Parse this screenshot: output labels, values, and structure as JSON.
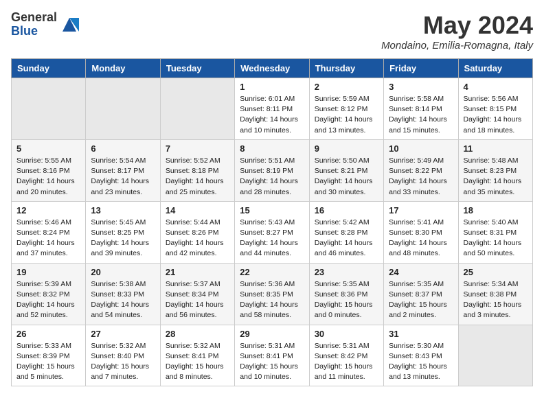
{
  "logo": {
    "general": "General",
    "blue": "Blue"
  },
  "title": "May 2024",
  "location": "Mondaino, Emilia-Romagna, Italy",
  "days_of_week": [
    "Sunday",
    "Monday",
    "Tuesday",
    "Wednesday",
    "Thursday",
    "Friday",
    "Saturday"
  ],
  "weeks": [
    {
      "days": [
        {
          "number": "",
          "info": "",
          "empty": true
        },
        {
          "number": "",
          "info": "",
          "empty": true
        },
        {
          "number": "",
          "info": "",
          "empty": true
        },
        {
          "number": "1",
          "info": "Sunrise: 6:01 AM\nSunset: 8:11 PM\nDaylight: 14 hours\nand 10 minutes."
        },
        {
          "number": "2",
          "info": "Sunrise: 5:59 AM\nSunset: 8:12 PM\nDaylight: 14 hours\nand 13 minutes."
        },
        {
          "number": "3",
          "info": "Sunrise: 5:58 AM\nSunset: 8:14 PM\nDaylight: 14 hours\nand 15 minutes."
        },
        {
          "number": "4",
          "info": "Sunrise: 5:56 AM\nSunset: 8:15 PM\nDaylight: 14 hours\nand 18 minutes."
        }
      ]
    },
    {
      "days": [
        {
          "number": "5",
          "info": "Sunrise: 5:55 AM\nSunset: 8:16 PM\nDaylight: 14 hours\nand 20 minutes."
        },
        {
          "number": "6",
          "info": "Sunrise: 5:54 AM\nSunset: 8:17 PM\nDaylight: 14 hours\nand 23 minutes."
        },
        {
          "number": "7",
          "info": "Sunrise: 5:52 AM\nSunset: 8:18 PM\nDaylight: 14 hours\nand 25 minutes."
        },
        {
          "number": "8",
          "info": "Sunrise: 5:51 AM\nSunset: 8:19 PM\nDaylight: 14 hours\nand 28 minutes."
        },
        {
          "number": "9",
          "info": "Sunrise: 5:50 AM\nSunset: 8:21 PM\nDaylight: 14 hours\nand 30 minutes."
        },
        {
          "number": "10",
          "info": "Sunrise: 5:49 AM\nSunset: 8:22 PM\nDaylight: 14 hours\nand 33 minutes."
        },
        {
          "number": "11",
          "info": "Sunrise: 5:48 AM\nSunset: 8:23 PM\nDaylight: 14 hours\nand 35 minutes."
        }
      ]
    },
    {
      "days": [
        {
          "number": "12",
          "info": "Sunrise: 5:46 AM\nSunset: 8:24 PM\nDaylight: 14 hours\nand 37 minutes."
        },
        {
          "number": "13",
          "info": "Sunrise: 5:45 AM\nSunset: 8:25 PM\nDaylight: 14 hours\nand 39 minutes."
        },
        {
          "number": "14",
          "info": "Sunrise: 5:44 AM\nSunset: 8:26 PM\nDaylight: 14 hours\nand 42 minutes."
        },
        {
          "number": "15",
          "info": "Sunrise: 5:43 AM\nSunset: 8:27 PM\nDaylight: 14 hours\nand 44 minutes."
        },
        {
          "number": "16",
          "info": "Sunrise: 5:42 AM\nSunset: 8:28 PM\nDaylight: 14 hours\nand 46 minutes."
        },
        {
          "number": "17",
          "info": "Sunrise: 5:41 AM\nSunset: 8:30 PM\nDaylight: 14 hours\nand 48 minutes."
        },
        {
          "number": "18",
          "info": "Sunrise: 5:40 AM\nSunset: 8:31 PM\nDaylight: 14 hours\nand 50 minutes."
        }
      ]
    },
    {
      "days": [
        {
          "number": "19",
          "info": "Sunrise: 5:39 AM\nSunset: 8:32 PM\nDaylight: 14 hours\nand 52 minutes."
        },
        {
          "number": "20",
          "info": "Sunrise: 5:38 AM\nSunset: 8:33 PM\nDaylight: 14 hours\nand 54 minutes."
        },
        {
          "number": "21",
          "info": "Sunrise: 5:37 AM\nSunset: 8:34 PM\nDaylight: 14 hours\nand 56 minutes."
        },
        {
          "number": "22",
          "info": "Sunrise: 5:36 AM\nSunset: 8:35 PM\nDaylight: 14 hours\nand 58 minutes."
        },
        {
          "number": "23",
          "info": "Sunrise: 5:35 AM\nSunset: 8:36 PM\nDaylight: 15 hours\nand 0 minutes."
        },
        {
          "number": "24",
          "info": "Sunrise: 5:35 AM\nSunset: 8:37 PM\nDaylight: 15 hours\nand 2 minutes."
        },
        {
          "number": "25",
          "info": "Sunrise: 5:34 AM\nSunset: 8:38 PM\nDaylight: 15 hours\nand 3 minutes."
        }
      ]
    },
    {
      "days": [
        {
          "number": "26",
          "info": "Sunrise: 5:33 AM\nSunset: 8:39 PM\nDaylight: 15 hours\nand 5 minutes."
        },
        {
          "number": "27",
          "info": "Sunrise: 5:32 AM\nSunset: 8:40 PM\nDaylight: 15 hours\nand 7 minutes."
        },
        {
          "number": "28",
          "info": "Sunrise: 5:32 AM\nSunset: 8:41 PM\nDaylight: 15 hours\nand 8 minutes."
        },
        {
          "number": "29",
          "info": "Sunrise: 5:31 AM\nSunset: 8:41 PM\nDaylight: 15 hours\nand 10 minutes."
        },
        {
          "number": "30",
          "info": "Sunrise: 5:31 AM\nSunset: 8:42 PM\nDaylight: 15 hours\nand 11 minutes."
        },
        {
          "number": "31",
          "info": "Sunrise: 5:30 AM\nSunset: 8:43 PM\nDaylight: 15 hours\nand 13 minutes."
        },
        {
          "number": "",
          "info": "",
          "empty": true
        }
      ]
    }
  ]
}
